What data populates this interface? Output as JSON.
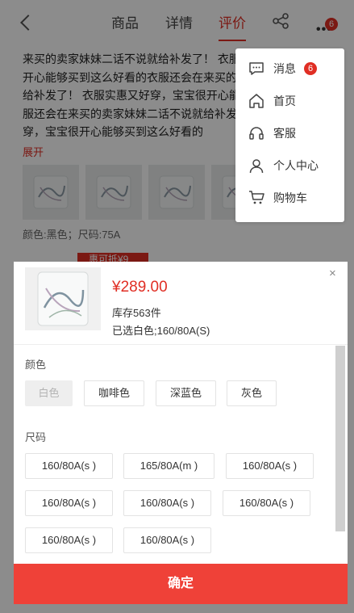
{
  "header": {
    "tabs": [
      "商品",
      "详情",
      "评价"
    ],
    "active_tab": "评价",
    "more_badge": "6"
  },
  "review": {
    "text": "来买的卖家妹妹二话不说就给补发了！ 衣服实惠又好穿，宝宝很开心能够买到这么好看的衣服还会在来买的卖家妹妹二话不说就给补发了！ 衣服实惠又好穿，宝宝很开心能够买到这么好看的衣服还会在来买的卖家妹妹二话不说就给补发了！ 衣服实惠又好穿，宝宝很开心能够买到这么好看的",
    "expand_label": "展开",
    "spec": "颜色:黑色；尺码:75A",
    "voucher": "惠可抵¥9"
  },
  "menu": {
    "items": [
      {
        "label": "消息",
        "icon": "message-icon",
        "badge": "6"
      },
      {
        "label": "首页",
        "icon": "home-icon"
      },
      {
        "label": "客服",
        "icon": "headset-icon"
      },
      {
        "label": "个人中心",
        "icon": "user-icon"
      },
      {
        "label": "购物车",
        "icon": "cart-icon"
      }
    ]
  },
  "sheet": {
    "price": "¥289.00",
    "stock": "库存563件",
    "selected": "已选白色;160/80A(S)",
    "close": "×",
    "color_title": "颜色",
    "colors": [
      "白色",
      "咖啡色",
      "深蓝色",
      "灰色"
    ],
    "size_title": "尺码",
    "sizes": [
      "160/80A(s )",
      "165/80A(m )",
      "160/80A(s )",
      "160/80A(s )",
      "160/80A(s )",
      "160/80A(s )",
      "160/80A(s )",
      "160/80A(s )"
    ],
    "confirm": "确定"
  },
  "colors": {
    "accent": "#e02e24",
    "confirm_bg": "#ef4138"
  }
}
